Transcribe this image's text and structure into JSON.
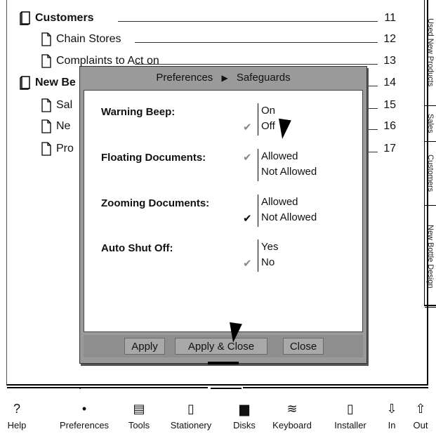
{
  "toc": [
    {
      "label": "Customers",
      "page": "11",
      "bold": true,
      "icon": "notebook-icon"
    },
    {
      "label": "Chain Stores",
      "page": "12",
      "bold": false,
      "icon": "document-icon"
    },
    {
      "label": "Complaints to Act on",
      "page": "13",
      "bold": false,
      "icon": "document-icon"
    },
    {
      "label": "New Be",
      "page": "14",
      "bold": true,
      "icon": "notebook-icon"
    },
    {
      "label": "Sal",
      "page": "15",
      "bold": false,
      "icon": "document-icon"
    },
    {
      "label": "Ne",
      "page": "16",
      "bold": false,
      "icon": "document-icon"
    },
    {
      "label": "Pro",
      "page": "17",
      "bold": false,
      "icon": "document-icon"
    }
  ],
  "tabs": [
    "Used New Products",
    "Sales",
    "Customers",
    "New Bottle Design"
  ],
  "dialog": {
    "breadcrumb_parent": "Preferences",
    "breadcrumb_arrow": "▶",
    "breadcrumb_current": "Safeguards",
    "options": [
      {
        "label": "Warning Beep:",
        "values": [
          "On",
          "Off"
        ],
        "checked_index": 1,
        "check_style": "grey"
      },
      {
        "label": "Floating Documents:",
        "values": [
          "Allowed",
          "Not Allowed"
        ],
        "checked_index": 0,
        "check_style": "grey"
      },
      {
        "label": "Zooming Documents:",
        "values": [
          "Allowed",
          "Not Allowed"
        ],
        "checked_index": 1,
        "check_style": "black"
      },
      {
        "label": "Auto Shut Off:",
        "values": [
          "Yes",
          "No"
        ],
        "checked_index": 1,
        "check_style": "grey"
      }
    ],
    "buttons": {
      "apply": "Apply",
      "apply_close": "Apply & Close",
      "close": "Close"
    }
  },
  "toolbar": [
    {
      "label": "Help",
      "glyph": "?",
      "icon": "help-icon"
    },
    {
      "label": "Preferences",
      "glyph": "•",
      "icon": "preferences-icon"
    },
    {
      "label": "Tools",
      "glyph": "▤",
      "icon": "tools-icon"
    },
    {
      "label": "Stationery",
      "glyph": "▯",
      "icon": "stationery-icon"
    },
    {
      "label": "Disks",
      "glyph": "▆",
      "icon": "disk-icon"
    },
    {
      "label": "Keyboard",
      "glyph": "≋",
      "icon": "keyboard-icon"
    },
    {
      "label": "Installer",
      "glyph": "▯",
      "icon": "installer-icon"
    },
    {
      "label": "In",
      "glyph": "⇩",
      "icon": "in-arrow-icon"
    },
    {
      "label": "Out",
      "glyph": "⇧",
      "icon": "out-arrow-icon"
    }
  ],
  "check_glyph": "✔"
}
